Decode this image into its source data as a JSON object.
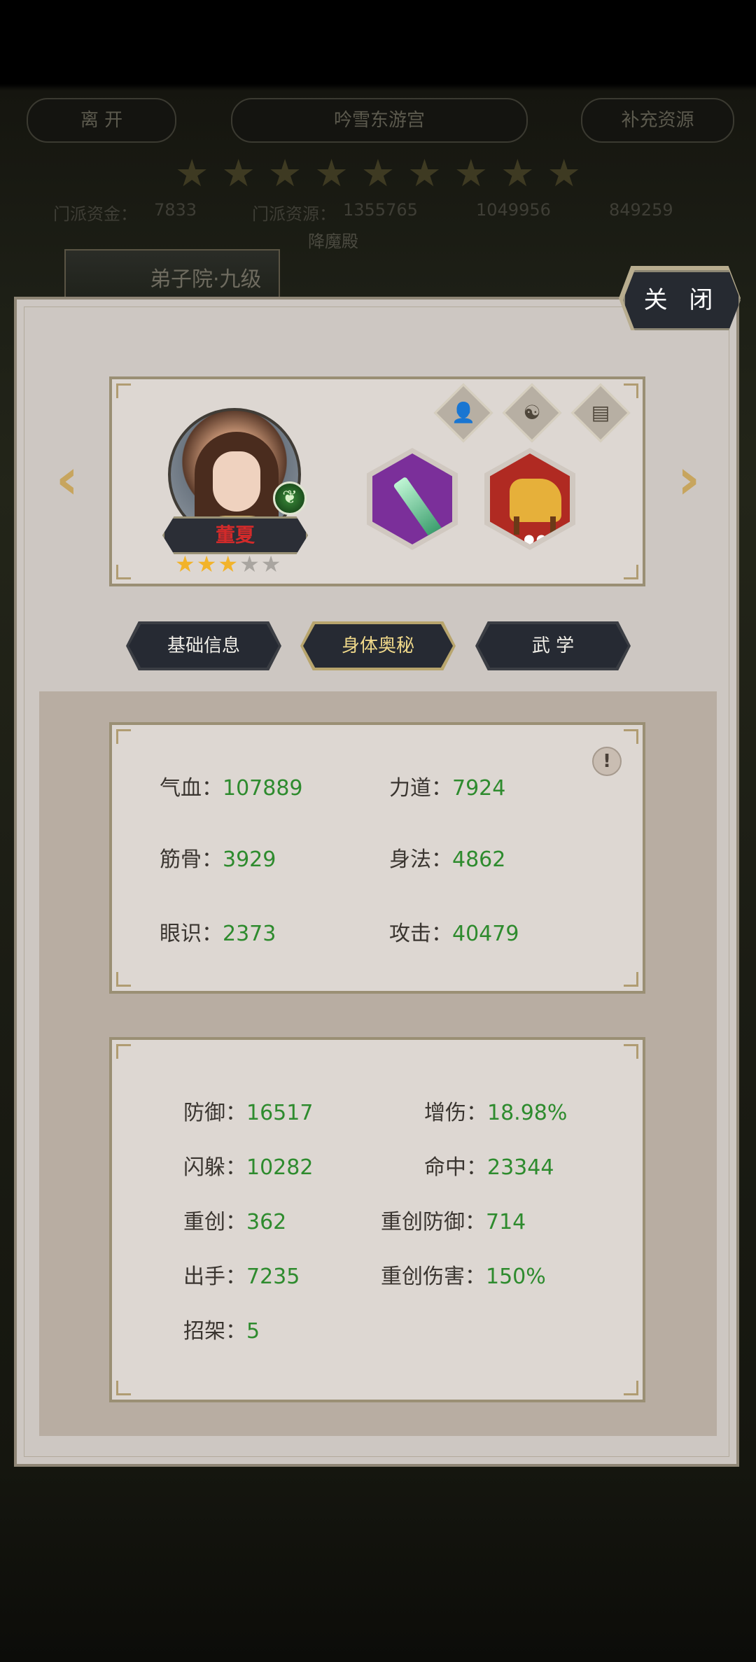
{
  "background": {
    "leave_label": "离 开",
    "location_title": "吟雪东游宫",
    "supplement_label": "补充资源",
    "sect_fund_label": "门派资金：",
    "sect_fund_value": "7833",
    "sect_resource_label": "门派资源：",
    "sect_resource_value": "1355765",
    "value_3": "1049956",
    "value_4": "849259",
    "tile_label": "弟子院·九级",
    "subtitle_fragment": "降魔殿"
  },
  "panel": {
    "close_label": "关 闭"
  },
  "hero": {
    "name": "董夏",
    "stars_filled": 3,
    "stars_total": 5
  },
  "tabs": [
    {
      "label": "基础信息",
      "active": false
    },
    {
      "label": "身体奥秘",
      "active": true
    },
    {
      "label": "武 学",
      "active": false
    }
  ],
  "base_stats": [
    {
      "label": "气血：",
      "value": "107889"
    },
    {
      "label": "力道：",
      "value": "7924"
    },
    {
      "label": "筋骨：",
      "value": "3929"
    },
    {
      "label": "身法：",
      "value": "4862"
    },
    {
      "label": "眼识：",
      "value": "2373"
    },
    {
      "label": "攻击：",
      "value": "40479"
    }
  ],
  "combat_stats": [
    {
      "label": "防御：",
      "value": "16517"
    },
    {
      "label": "增伤：",
      "value": "18.98%"
    },
    {
      "label": "闪躲：",
      "value": "10282"
    },
    {
      "label": "命中：",
      "value": "23344"
    },
    {
      "label": "重创：",
      "value": "362"
    },
    {
      "label": "重创防御：",
      "value": "714"
    },
    {
      "label": "出手：",
      "value": "7235"
    },
    {
      "label": "重创伤害：",
      "value": "150%"
    },
    {
      "label": "招架：",
      "value": "5"
    }
  ],
  "colors": {
    "value_green": "#2e8b2e",
    "name_red": "#d22a2a",
    "star_gold": "#f2b32a",
    "panel_bg": "#cdc7c2"
  },
  "icons": {
    "left_arrow": "chevron-left-icon",
    "right_arrow": "chevron-right-icon",
    "weapon": "sword-icon",
    "mount": "horse-icon",
    "info": "exclamation-icon"
  }
}
